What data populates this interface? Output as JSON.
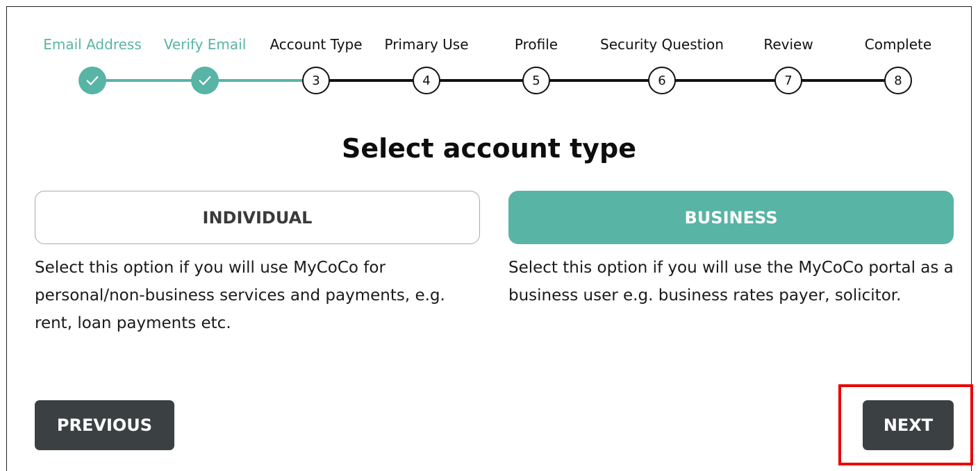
{
  "stepper": {
    "steps": [
      {
        "label": "Email Address",
        "status": "done"
      },
      {
        "label": "Verify Email",
        "status": "done"
      },
      {
        "label": "Account Type",
        "number": "3",
        "status": "todo"
      },
      {
        "label": "Primary Use",
        "number": "4",
        "status": "todo"
      },
      {
        "label": "Profile",
        "number": "5",
        "status": "todo"
      },
      {
        "label": "Security Question",
        "number": "6",
        "status": "todo"
      },
      {
        "label": "Review",
        "number": "7",
        "status": "todo"
      },
      {
        "label": "Complete",
        "number": "8",
        "status": "todo"
      }
    ]
  },
  "page": {
    "title": "Select account type"
  },
  "options": {
    "individual": {
      "label": "INDIVIDUAL",
      "description": "Select this option if you will use MyCoCo for personal/non-business services and payments, e.g. rent, loan payments etc."
    },
    "business": {
      "label": "BUSINESS",
      "description": "Select this option if you will use the MyCoCo portal as a business user e.g. business rates payer, solicitor.",
      "selected": true
    }
  },
  "navigation": {
    "previous_label": "PREVIOUS",
    "next_label": "NEXT"
  },
  "colors": {
    "accent": "#58b4a5",
    "dark_button": "#3b4042",
    "highlight": "#ea0000"
  }
}
